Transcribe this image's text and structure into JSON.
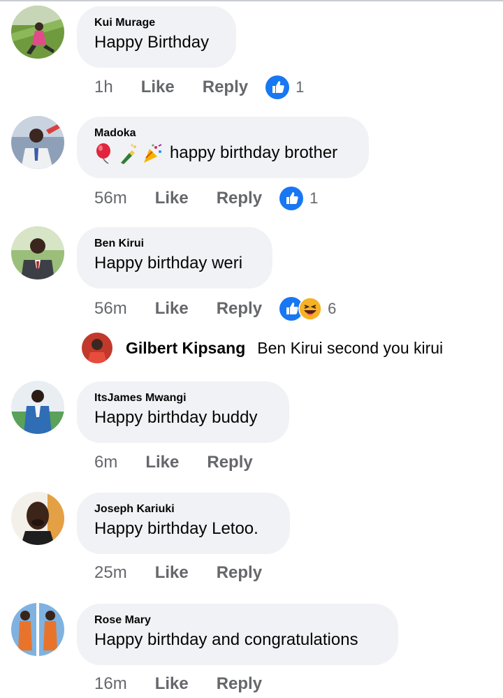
{
  "comments": [
    {
      "author": "Kui Murage",
      "text": "Happy Birthday",
      "time": "1h",
      "like_label": "Like",
      "reply_label": "Reply",
      "reaction_count": "1",
      "reactions": [
        "like-icon"
      ]
    },
    {
      "author": "Madoka",
      "text": "happy birthday brother",
      "emojis": [
        "balloon-emoji",
        "champagne-emoji",
        "party-popper-emoji"
      ],
      "time": "56m",
      "like_label": "Like",
      "reply_label": "Reply",
      "reaction_count": "1",
      "reactions": [
        "like-icon"
      ]
    },
    {
      "author": "Ben Kirui",
      "text": "Happy birthday weri",
      "time": "56m",
      "like_label": "Like",
      "reply_label": "Reply",
      "reaction_count": "6",
      "reactions": [
        "like-icon",
        "haha-icon"
      ]
    },
    {
      "author": "ItsJames Mwangi",
      "text": "Happy birthday buddy",
      "time": "6m",
      "like_label": "Like",
      "reply_label": "Reply"
    },
    {
      "author": "Joseph Kariuki",
      "text": "Happy birthday Letoo.",
      "time": "25m",
      "like_label": "Like",
      "reply_label": "Reply"
    },
    {
      "author": "Rose Mary",
      "text": "Happy birthday and congratulations",
      "time": "16m",
      "like_label": "Like",
      "reply_label": "Reply"
    }
  ],
  "reply_preview": {
    "author": "Gilbert Kipsang",
    "text": "Ben Kirui second you kirui"
  },
  "colors": {
    "bubble": "#f0f2f5",
    "meta_text": "#65676b",
    "like_blue": "#1877f2",
    "haha_yellow": "#f7b125"
  }
}
